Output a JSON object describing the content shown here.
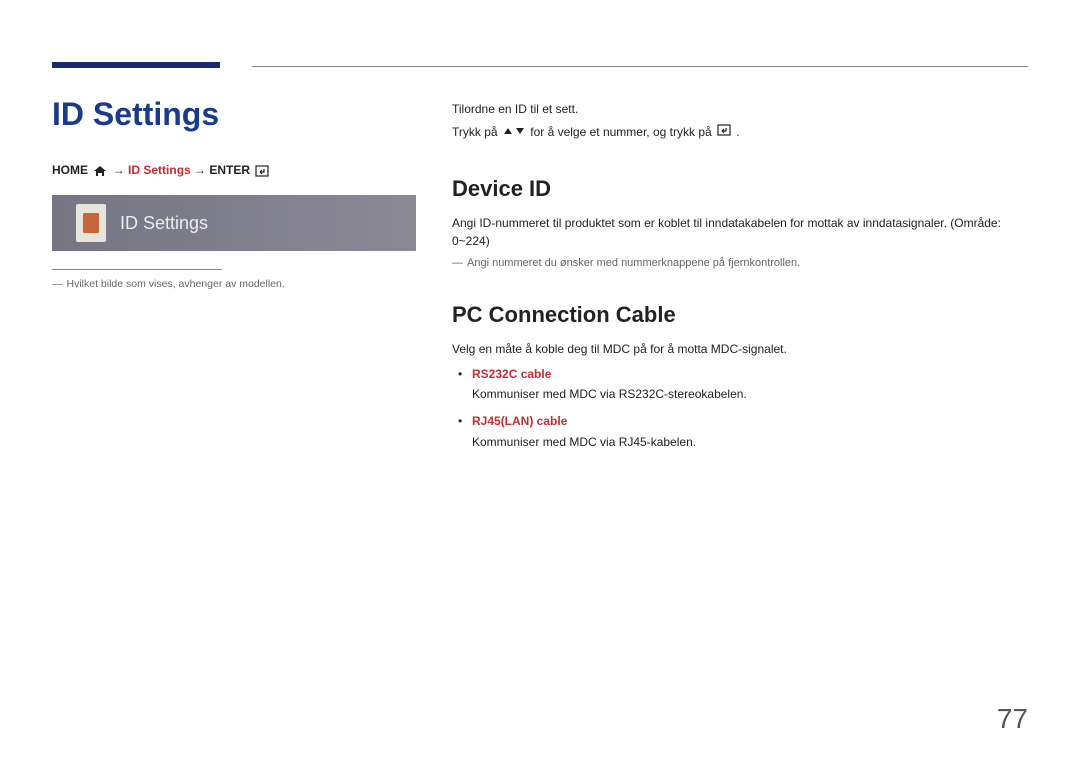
{
  "title": "ID Settings",
  "breadcrumb": {
    "home": "HOME",
    "arrow1": " → ",
    "mid": "ID Settings",
    "arrow2": " → ",
    "enter": "ENTER"
  },
  "ui_preview": {
    "label": "ID Settings"
  },
  "left_footnote": "Hvilket bilde som vises, avhenger av modellen.",
  "intro": {
    "line1": "Tilordne en ID til et sett.",
    "line2a": "Trykk på ",
    "line2b": " for å velge et nummer, og trykk på ",
    "line2c": "."
  },
  "section1": {
    "heading": "Device ID",
    "body": "Angi ID-nummeret til produktet som er koblet til inndatakabelen for mottak av inndatasignaler. (Område: 0~224)",
    "note": "Angi nummeret du ønsker med nummerknappene på fjernkontrollen."
  },
  "section2": {
    "heading": "PC Connection Cable",
    "body": "Velg en måte å koble deg til MDC på for å motta MDC-signalet.",
    "options": [
      {
        "label": "RS232C cable",
        "desc": "Kommuniser med MDC via RS232C-stereokabelen."
      },
      {
        "label": "RJ45(LAN) cable",
        "desc": "Kommuniser med MDC via RJ45-kabelen."
      }
    ]
  },
  "page_number": "77"
}
